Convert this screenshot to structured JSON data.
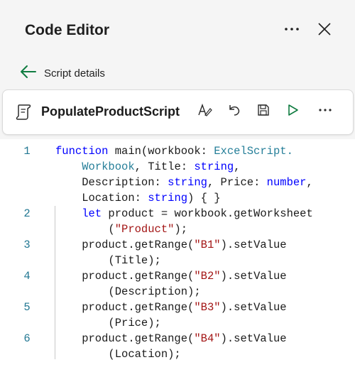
{
  "header": {
    "title": "Code Editor",
    "more_icon": "more-horizontal-icon",
    "close_icon": "close-icon"
  },
  "back": {
    "label": "Script details",
    "icon": "arrow-left-icon"
  },
  "script": {
    "name": "PopulateProductScript",
    "icon": "script-scroll-icon",
    "toolbar": [
      "format-icon",
      "undo-icon",
      "save-icon",
      "run-icon",
      "more-horizontal-icon"
    ]
  },
  "code": {
    "lines": [
      {
        "number": "1",
        "rows": [
          [
            {
              "t": "function",
              "c": "kw"
            },
            {
              "t": " main(workbook: "
            },
            {
              "t": "ExcelScript.",
              "c": "ty"
            }
          ],
          [
            {
              "t": "    "
            },
            {
              "t": "Workbook",
              "c": "ty"
            },
            {
              "t": ", Title: "
            },
            {
              "t": "string",
              "c": "kw"
            },
            {
              "t": ","
            }
          ],
          [
            {
              "t": "    Description: "
            },
            {
              "t": "string",
              "c": "kw"
            },
            {
              "t": ", Price: "
            },
            {
              "t": "number",
              "c": "kw"
            },
            {
              "t": ","
            }
          ],
          [
            {
              "t": "    Location: "
            },
            {
              "t": "string",
              "c": "kw"
            },
            {
              "t": ") { }"
            }
          ]
        ]
      },
      {
        "number": "2",
        "rows": [
          [
            {
              "t": "    "
            },
            {
              "t": "let",
              "c": "kw"
            },
            {
              "t": " product = workbook.getWorksheet"
            }
          ],
          [
            {
              "t": "        ("
            },
            {
              "t": "\"Product\"",
              "c": "str"
            },
            {
              "t": ");"
            }
          ]
        ]
      },
      {
        "number": "3",
        "rows": [
          [
            {
              "t": "    product.getRange("
            },
            {
              "t": "\"B1\"",
              "c": "str"
            },
            {
              "t": ").setValue"
            }
          ],
          [
            {
              "t": "        (Title);"
            }
          ]
        ]
      },
      {
        "number": "4",
        "rows": [
          [
            {
              "t": "    product.getRange("
            },
            {
              "t": "\"B2\"",
              "c": "str"
            },
            {
              "t": ").setValue"
            }
          ],
          [
            {
              "t": "        (Description);"
            }
          ]
        ]
      },
      {
        "number": "5",
        "rows": [
          [
            {
              "t": "    product.getRange("
            },
            {
              "t": "\"B3\"",
              "c": "str"
            },
            {
              "t": ").setValue"
            }
          ],
          [
            {
              "t": "        (Price);"
            }
          ]
        ]
      },
      {
        "number": "6",
        "rows": [
          [
            {
              "t": "    product.getRange("
            },
            {
              "t": "\"B4\"",
              "c": "str"
            },
            {
              "t": ").setValue"
            }
          ],
          [
            {
              "t": "        (Location);"
            }
          ]
        ]
      }
    ]
  }
}
